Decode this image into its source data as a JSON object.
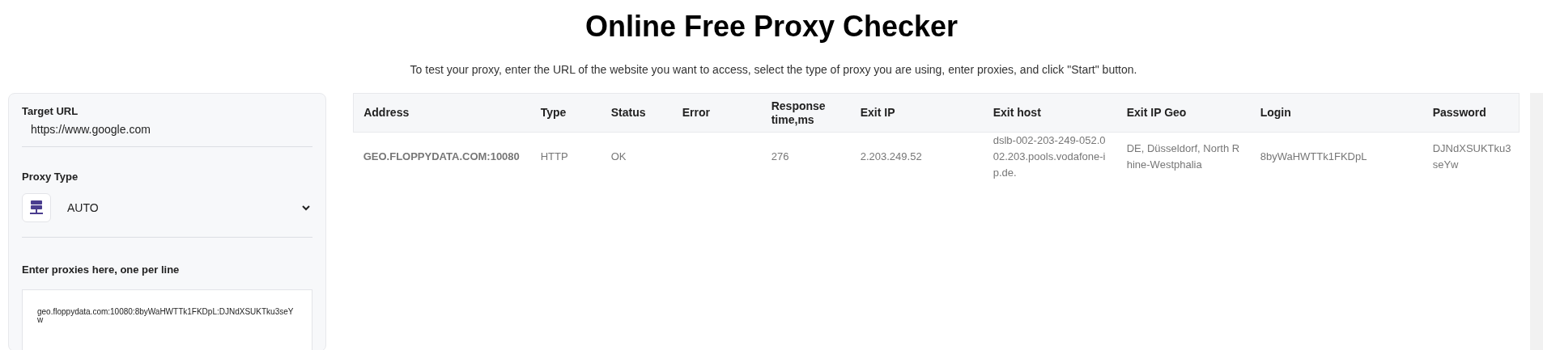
{
  "title": "Online Free Proxy Checker",
  "intro": "To test your proxy, enter the URL of the website you want to access, select the type of proxy you are using, enter proxies, and click \"Start\" button.",
  "form": {
    "target_url": {
      "label": "Target URL",
      "value": "https://www.google.com"
    },
    "proxy_type": {
      "label": "Proxy Type",
      "value": "AUTO"
    },
    "proxies": {
      "label": "Enter proxies here, one per line",
      "value": "geo.floppydata.com:10080:8byWaHWTTk1FKDpL:DJNdXSUKTku3seYw"
    }
  },
  "table": {
    "columns": [
      "Address",
      "Type",
      "Status",
      "Error",
      "Response time,ms",
      "Exit IP",
      "Exit host",
      "Exit IP Geo",
      "Login",
      "Password"
    ],
    "rows": [
      [
        "GEO.FLOPPYDATA.COM:10080",
        "HTTP",
        "OK",
        "",
        "276",
        "2.203.249.52",
        "dslb-002-203-249-052.002.203.pools.vodafone-ip.de.",
        "DE, Düsseldorf, North Rhine-Westphalia",
        "8byWaHWTTk1FKDpL",
        "DJNdXSUKTku3seYw"
      ]
    ]
  }
}
